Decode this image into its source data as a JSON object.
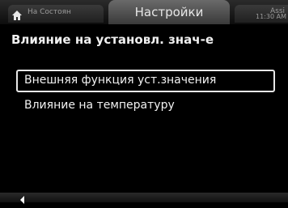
{
  "header": {
    "home_tab_label": "На Состоян",
    "title_tab_label": "Настройки",
    "right_tab_label": "Assi",
    "clock": "11:30 AM"
  },
  "page": {
    "title": "Влияние на установл. знач-е"
  },
  "menu": {
    "items": [
      {
        "label": "Внешняя функция уст.значения",
        "selected": true
      },
      {
        "label": "Влияние на температуру",
        "selected": false
      }
    ]
  },
  "icons": {
    "home": "home-icon",
    "back": "back-arrow-icon"
  }
}
